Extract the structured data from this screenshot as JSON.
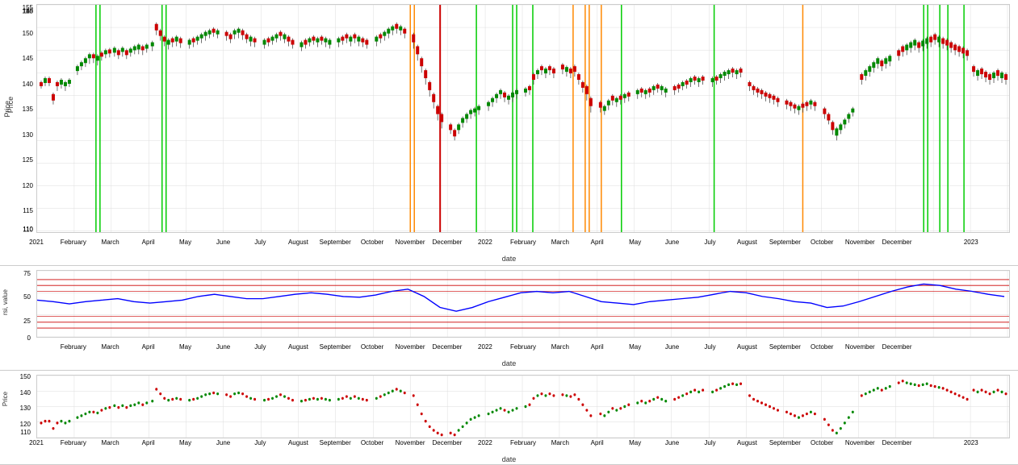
{
  "charts": [
    {
      "id": "price-chart",
      "y_label": "Price",
      "x_label": "date",
      "y_min": 110,
      "y_max": 155,
      "y_ticks": [
        110,
        115,
        120,
        125,
        130,
        135,
        140,
        145,
        150,
        155
      ],
      "x_ticks": [
        "2021",
        "February",
        "March",
        "April",
        "May",
        "June",
        "July",
        "August",
        "September",
        "October",
        "November",
        "December",
        "2022",
        "February",
        "March",
        "April",
        "May",
        "June",
        "July",
        "August",
        "September",
        "October",
        "November",
        "December",
        "2023"
      ]
    },
    {
      "id": "rsi-chart",
      "y_label": "rsi, value",
      "x_label": "date",
      "y_min": 0,
      "y_max": 75,
      "y_ticks": [
        0,
        25,
        50,
        75
      ],
      "x_ticks": [
        "February",
        "March",
        "April",
        "May",
        "June",
        "July",
        "August",
        "September",
        "October",
        "November",
        "December",
        "2022",
        "February",
        "March",
        "April",
        "May",
        "June",
        "July",
        "August",
        "September",
        "October",
        "November",
        "December"
      ]
    },
    {
      "id": "price-chart-2",
      "y_label": "Price",
      "x_label": "date",
      "y_min": 110,
      "y_max": 150,
      "y_ticks": [
        110,
        120,
        130,
        140,
        150
      ],
      "x_ticks": [
        "2021",
        "February",
        "March",
        "April",
        "May",
        "June",
        "July",
        "August",
        "September",
        "October",
        "November",
        "December",
        "2022",
        "February",
        "March",
        "April",
        "May",
        "June",
        "July",
        "August",
        "September",
        "October",
        "November",
        "December",
        "2023"
      ]
    }
  ]
}
